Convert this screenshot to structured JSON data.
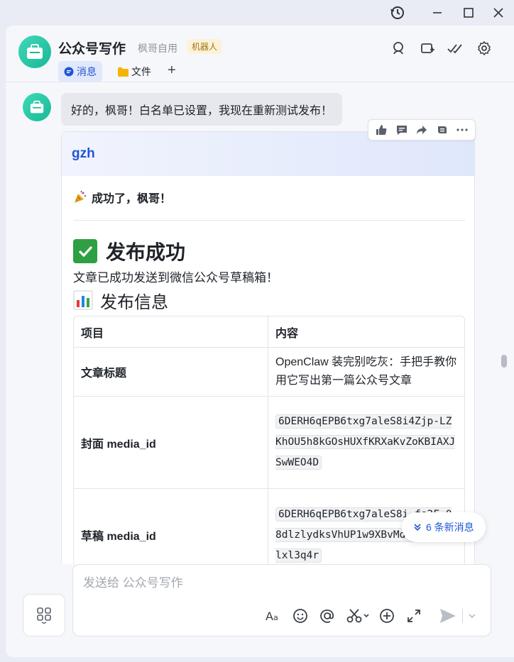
{
  "window": {
    "history_icon": "history-icon",
    "minimize_icon": "minimize-icon",
    "maximize_icon": "maximize-icon",
    "close_icon": "close-icon"
  },
  "header": {
    "title": "公众号写作",
    "subtitle": "枫哥自用",
    "badge": "机器人",
    "tabs": [
      {
        "label": "消息",
        "icon": "chat-bubble-icon",
        "active": true
      },
      {
        "label": "文件",
        "icon": "folder-icon",
        "active": false
      }
    ],
    "add_tab": "+"
  },
  "message": {
    "text": "好的，枫哥！白名单已设置，我现在重新测试发布！",
    "actions": [
      "thumbs-up-icon",
      "comment-icon",
      "forward-icon",
      "pin-icon",
      "more-icon"
    ]
  },
  "card": {
    "title": "gzh",
    "success_line": "成功了，枫哥！",
    "h1": "发布成功",
    "desc": "文章已成功发送到微信公众号草稿箱！",
    "h2": "发布信息",
    "table": {
      "headers": [
        "项目",
        "内容"
      ],
      "rows": [
        {
          "label": "文章标题",
          "value": "OpenClaw 装完别吃灰：手把手教你用它写出第一篇公众号文章",
          "code": false
        },
        {
          "label": "封面 media_id",
          "value": "6DERH6qEPB6txg7aleS8i4Zjp-LZKhOU5h8kGOsHUXfKRXaKvZoKBIAXJSwWEO4D",
          "code": true
        },
        {
          "label": "草稿 media_id",
          "value": "6DERH6qEPB6txg7aleS8i-fs2F-08dlzlydksVhUP1w9XBvMdGNuh9DNslxl3q4r",
          "code": true
        }
      ]
    }
  },
  "new_messages": "6 条新消息",
  "composer": {
    "placeholder": "发送给 公众号写作"
  },
  "colors": {
    "accent": "#1f56d6",
    "bot_avatar": "#18b896",
    "success": "#2ea043"
  }
}
